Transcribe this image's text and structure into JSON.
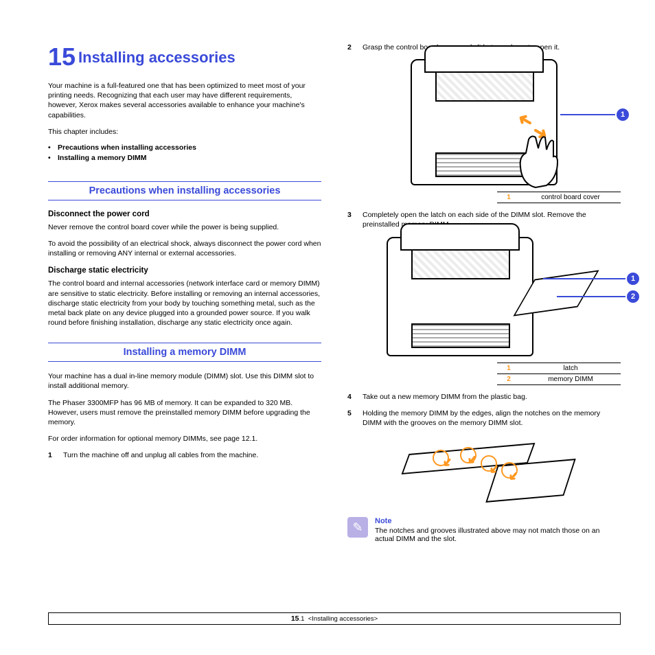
{
  "chapter": {
    "number": "15",
    "title": "Installing accessories"
  },
  "intro": "Your machine is a full-featured one that has been optimized to meet most of your printing needs. Recognizing that each user may have different requirements, however, Xerox makes several accessories available to enhance your machine's capabilities.",
  "includes_label": "This chapter includes:",
  "includes": [
    "Precautions when installing accessories",
    "Installing a memory DIMM"
  ],
  "section1": {
    "heading": "Precautions when installing accessories",
    "sub1_title": "Disconnect the power cord",
    "sub1_p1": "Never remove the control board cover while the power is being supplied.",
    "sub1_p2": "To avoid the possibility of an electrical shock, always disconnect the power cord when installing or removing ANY internal or external accessories.",
    "sub2_title": "Discharge static electricity",
    "sub2_p1": "The control board and internal accessories (network interface card or memory DIMM) are sensitive to static electricity. Before installing or removing an internal accessories, discharge static electricity from your body by touching something metal, such as the metal back plate on any device plugged into a grounded power source. If you walk round before finishing installation, discharge any static electricity once again."
  },
  "section2": {
    "heading": "Installing a memory DIMM",
    "p1": "Your machine has a dual in-line memory module (DIMM) slot. Use this DIMM slot to install additional memory.",
    "p2": "The Phaser 3300MFP has 96 MB of memory. It can be expanded to 320 MB. However, users must remove the preinstalled memory DIMM before upgrading the memory.",
    "p3": "For order information for optional memory DIMMs, see page 12.1.",
    "steps": {
      "s1": "Turn the machine off and unplug all cables from the machine.",
      "s2": "Grasp the control board cover and slide toward you to open it.",
      "s3": "Completely open the latch on each side of the DIMM slot. Remove the preinstalled memory DIMM.",
      "s4": "Take out a new memory DIMM from the plastic bag.",
      "s5": "Holding the memory DIMM by the edges, align the notches on the memory DIMM with the grooves on the memory DIMM slot."
    }
  },
  "callouts": {
    "c1": "1",
    "c2": "2"
  },
  "legend1": {
    "k1": "1",
    "v1": "control board cover"
  },
  "legend2": {
    "k1": "1",
    "v1": "latch",
    "k2": "2",
    "v2": "memory DIMM"
  },
  "note": {
    "title": "Note",
    "text": "The notches and grooves illustrated above may not match those on an actual DIMM and the slot."
  },
  "footer": {
    "pagenum_bold": "15",
    "pagenum_rest": ".1",
    "crumb": "<Installing accessories>"
  }
}
